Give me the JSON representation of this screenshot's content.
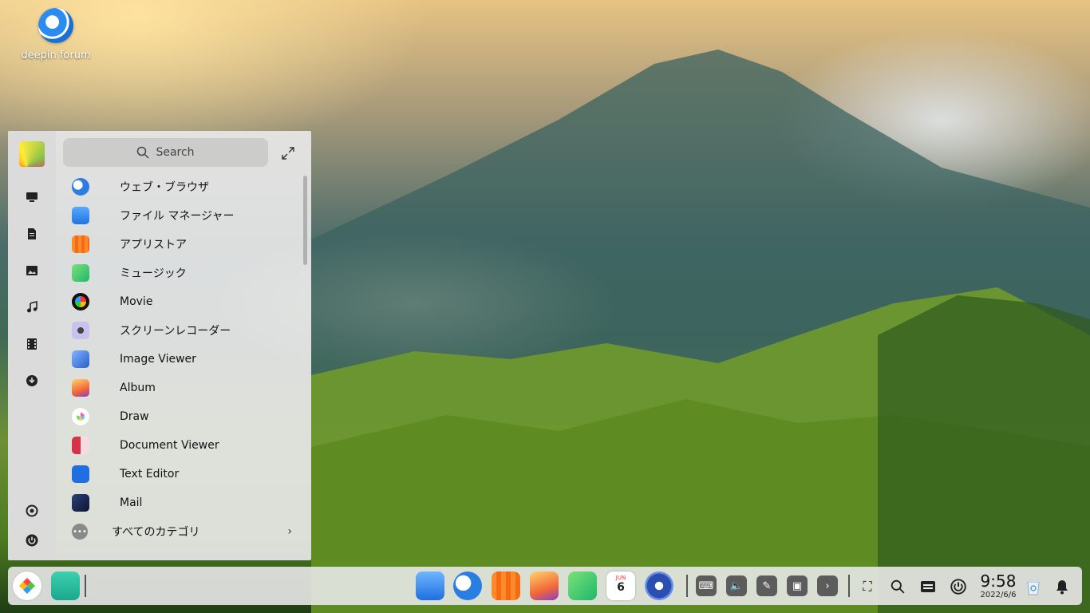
{
  "desktop": {
    "icon_label": "deepin forum"
  },
  "launcher": {
    "search_placeholder": "Search",
    "apps": [
      {
        "label": "ウェブ・ブラウザ",
        "icon": "browser-icon",
        "color": "#2a7de1"
      },
      {
        "label": "ファイル マネージャー",
        "icon": "file-manager-icon",
        "color": "#2b8ae8"
      },
      {
        "label": "アプリストア",
        "icon": "app-store-icon",
        "color": "#f47a1f"
      },
      {
        "label": "ミュージック",
        "icon": "music-icon",
        "color": "#35c46a"
      },
      {
        "label": "Movie",
        "icon": "movie-icon",
        "color": "#1a1a2e"
      },
      {
        "label": "スクリーンレコーダー",
        "icon": "screen-recorder-icon",
        "color": "#b9b3e8"
      },
      {
        "label": "Image Viewer",
        "icon": "image-viewer-icon",
        "color": "#3a6fd0"
      },
      {
        "label": "Album",
        "icon": "album-icon",
        "color": "#f39a3a"
      },
      {
        "label": "Draw",
        "icon": "draw-icon",
        "color": "#ffffff"
      },
      {
        "label": "Document Viewer",
        "icon": "document-viewer-icon",
        "color": "#d6334b"
      },
      {
        "label": "Text Editor",
        "icon": "text-editor-icon",
        "color": "#1f6fe0"
      },
      {
        "label": "Mail",
        "icon": "mail-icon",
        "color": "#1b2b5a"
      }
    ],
    "all_categories": "すべてのカテゴリ"
  },
  "dock": {
    "time": "9:58",
    "date": "2022/6/6",
    "calendar_month": "JUN",
    "calendar_day": "6"
  }
}
